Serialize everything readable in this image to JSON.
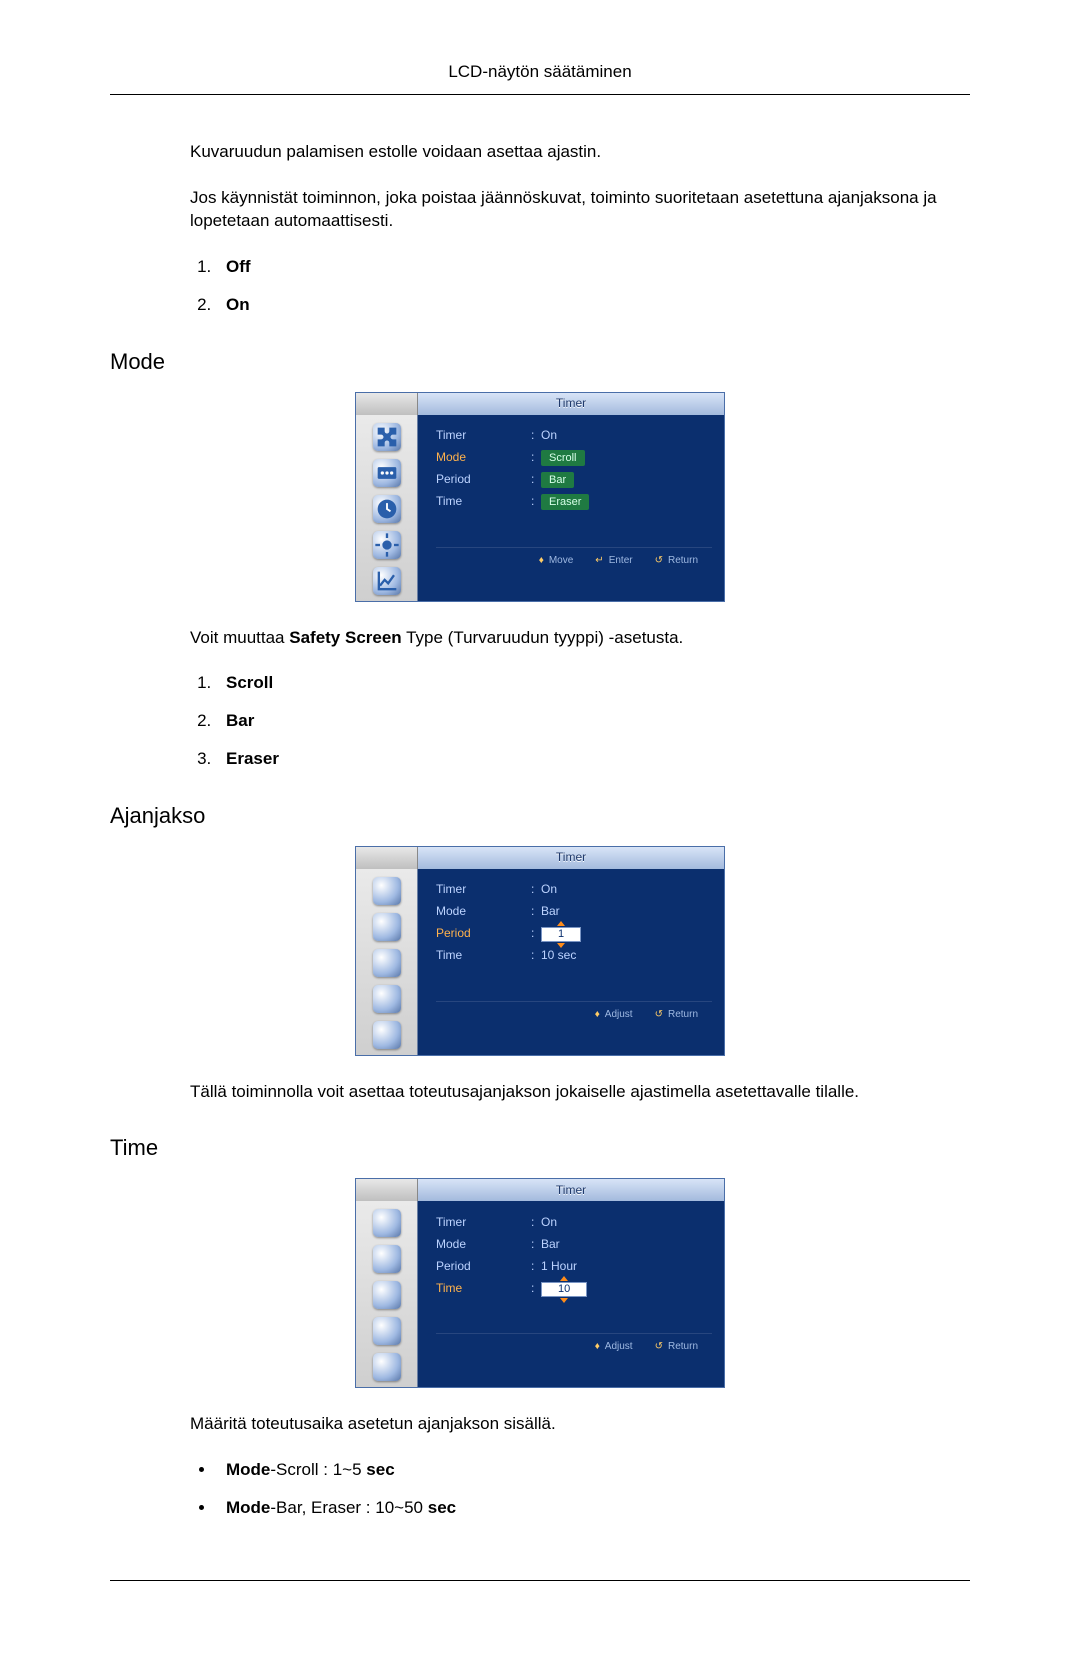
{
  "page": {
    "title": "LCD-näytön säätäminen"
  },
  "intro": {
    "p1": "Kuvaruudun palamisen estolle voidaan asettaa ajastin.",
    "p2": "Jos käynnistät toiminnon, joka poistaa jäännöskuvat, toiminto suoritetaan asetettuna ajanjaksona ja lopetetaan automaattisesti.",
    "list": [
      "Off",
      "On"
    ]
  },
  "mode": {
    "heading": "Mode",
    "after_para_pre": "Voit muuttaa ",
    "after_para_bold": "Safety Screen",
    "after_para_post": " Type (Turvaruudun tyyppi) -asetusta.",
    "list": [
      "Scroll",
      "Bar",
      "Eraser"
    ],
    "osd": {
      "title": "Timer",
      "rows": {
        "timer_label": "Timer",
        "timer_value": "On",
        "mode_label": "Mode",
        "mode_options": [
          "Scroll",
          "Bar",
          "Eraser"
        ],
        "period_label": "Period",
        "time_label": "Time"
      },
      "footer": {
        "move": "Move",
        "enter": "Enter",
        "return": "Return"
      },
      "highlight": "mode"
    }
  },
  "ajanjakso": {
    "heading": "Ajanjakso",
    "after_para": "Tällä toiminnolla voit asettaa toteutusajanjakson jokaiselle ajastimella asetettavalle tilalle.",
    "osd": {
      "title": "Timer",
      "rows": {
        "timer_label": "Timer",
        "timer_value": "On",
        "mode_label": "Mode",
        "mode_value": "Bar",
        "period_label": "Period",
        "period_value": "1",
        "time_label": "Time",
        "time_value": "10 sec"
      },
      "footer": {
        "adjust": "Adjust",
        "return": "Return"
      },
      "highlight": "period"
    }
  },
  "time": {
    "heading": "Time",
    "after_para": "Määritä toteutusaika asetetun ajanjakson sisällä.",
    "bullets": [
      {
        "bold": "Mode",
        "text": "-Scroll : 1~5 ",
        "tail_bold": "sec"
      },
      {
        "bold": "Mode",
        "text": "-Bar, Eraser : 10~50 ",
        "tail_bold": "sec"
      }
    ],
    "osd": {
      "title": "Timer",
      "rows": {
        "timer_label": "Timer",
        "timer_value": "On",
        "mode_label": "Mode",
        "mode_value": "Bar",
        "period_label": "Period",
        "period_value": "1 Hour",
        "time_label": "Time",
        "time_value": "10"
      },
      "footer": {
        "adjust": "Adjust",
        "return": "Return"
      },
      "highlight": "time"
    }
  }
}
